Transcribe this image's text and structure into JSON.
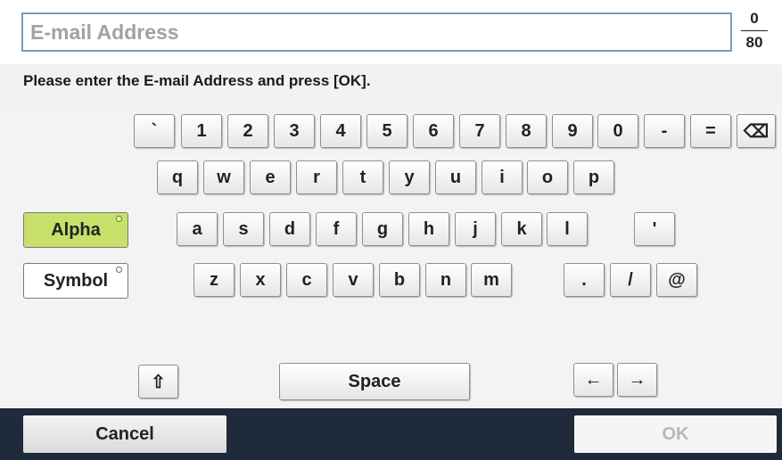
{
  "input": {
    "placeholder": "E-mail Address",
    "value": ""
  },
  "counter": {
    "current": "0",
    "max": "80"
  },
  "instruction": "Please enter the E-mail Address and press [OK].",
  "keyboard": {
    "row1": [
      "`",
      "1",
      "2",
      "3",
      "4",
      "5",
      "6",
      "7",
      "8",
      "9",
      "0",
      "-",
      "="
    ],
    "backspace_icon": "⌫",
    "row2": [
      "q",
      "w",
      "e",
      "r",
      "t",
      "y",
      "u",
      "i",
      "o",
      "p"
    ],
    "row3": [
      "a",
      "s",
      "d",
      "f",
      "g",
      "h",
      "j",
      "k",
      "l",
      "'"
    ],
    "row4": [
      "z",
      "x",
      "c",
      "v",
      "b",
      "n",
      "m",
      ".",
      "/",
      "@"
    ],
    "shift_icon": "⇧",
    "space_label": "Space",
    "left_arrow": "←",
    "right_arrow": "→"
  },
  "modes": {
    "alpha": "Alpha",
    "symbol": "Symbol",
    "active": "alpha",
    "active_color": "#c8e06a"
  },
  "footer": {
    "cancel": "Cancel",
    "ok": "OK",
    "background": "#1f2a3a"
  }
}
